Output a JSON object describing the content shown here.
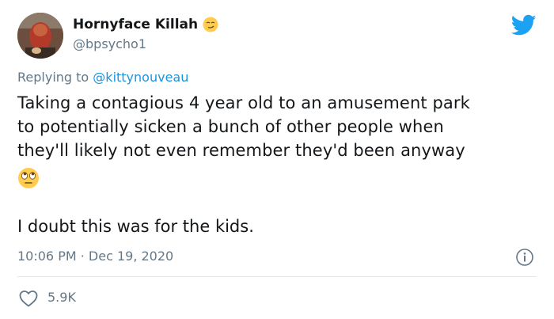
{
  "tweet": {
    "display_name": "Hornyface Killah",
    "handle": "@bpsycho1",
    "reply_prefix": "Replying to",
    "reply_mention": "@kittynouveau",
    "body_lines": [
      "Taking a contagious 4 year old to an amusement park",
      "to potentially sicken a bunch of other people when",
      "they'll likely not even remember they'd been anyway"
    ],
    "second_paragraph": "I doubt this was for the kids.",
    "timestamp": "10:06 PM · Dec 19, 2020",
    "like_count": "5.9K"
  },
  "icons": {
    "name_emoji": "smirk-emoji",
    "body_emoji": "rolling-eyes-emoji",
    "brand": "twitter-bird-icon",
    "info": "info-icon",
    "like": "heart-icon"
  },
  "colors": {
    "text": "#14171a",
    "muted": "#657786",
    "link": "#1b95e0",
    "twitter_blue": "#1da1f2",
    "divider": "#e1e8ed"
  }
}
